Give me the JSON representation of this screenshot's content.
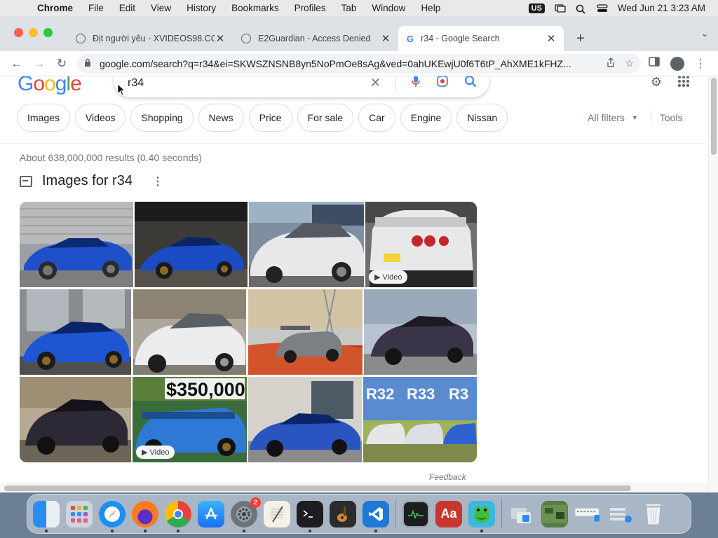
{
  "menubar": {
    "app_name": "Chrome",
    "items": [
      "File",
      "Edit",
      "View",
      "History",
      "Bookmarks",
      "Profiles",
      "Tab",
      "Window",
      "Help"
    ],
    "input_source": "US",
    "datetime": "Wed Jun 21  3:23 AM"
  },
  "tabs": [
    {
      "title": "Địt người yêu - XVIDEOS98.CC",
      "active": false
    },
    {
      "title": "E2Guardian - Access Denied",
      "active": false
    },
    {
      "title": "r34 - Google Search",
      "active": true
    }
  ],
  "toolbar": {
    "url": "google.com/search?q=r34&ei=SKWSZNSNB8yn5NoPmOe8sAg&ved=0ahUKEwjU0f6T6tP_AhXME1kFHZ..."
  },
  "google": {
    "logo_text": "Google",
    "query": "r34",
    "chips": [
      "Images",
      "Videos",
      "Shopping",
      "News",
      "Price",
      "For sale",
      "Car",
      "Engine",
      "Nissan"
    ],
    "all_filters": "All filters",
    "tools": "Tools",
    "result_stats": "About 638,000,000 results (0.40 seconds)",
    "images_heading": "Images for r34",
    "video_badge": "Video",
    "feedback": "Feedback",
    "banner_text": "$350,000",
    "r_labels": [
      "R32",
      "R33",
      "R3"
    ]
  },
  "dock": {
    "settings_badge": "2"
  },
  "colors": {
    "google_blue": "#4285f4",
    "google_red": "#ea4335",
    "google_yellow": "#fbbc05",
    "google_green": "#34a853",
    "bayside_blue": "#1f4fc9",
    "pearl_white": "#e8e8ea",
    "midnight_purple": "#3a3448"
  }
}
